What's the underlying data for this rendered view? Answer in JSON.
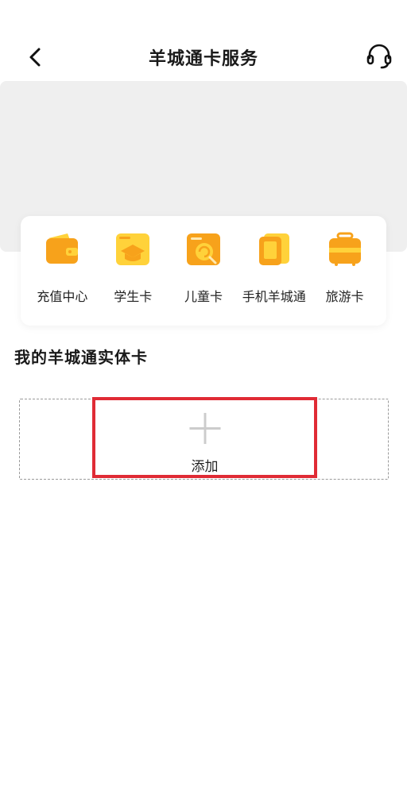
{
  "header": {
    "title": "羊城通卡服务",
    "back_icon": "chevron-left-icon",
    "service_icon": "headset-icon"
  },
  "banner": {},
  "menu": {
    "items": [
      {
        "label": "充值中心",
        "icon": "wallet-icon"
      },
      {
        "label": "学生卡",
        "icon": "graduation-cap-icon"
      },
      {
        "label": "儿童卡",
        "icon": "lollipop-card-icon"
      },
      {
        "label": "手机羊城通",
        "icon": "phone-card-icon"
      },
      {
        "label": "旅游卡",
        "icon": "luggage-icon"
      }
    ]
  },
  "physical_cards": {
    "section_title": "我的羊城通实体卡",
    "add_label": "添加"
  },
  "colors": {
    "accent_orange": "#f7a21b",
    "accent_yellow": "#ffd23a",
    "highlight_red": "#e02b35"
  }
}
